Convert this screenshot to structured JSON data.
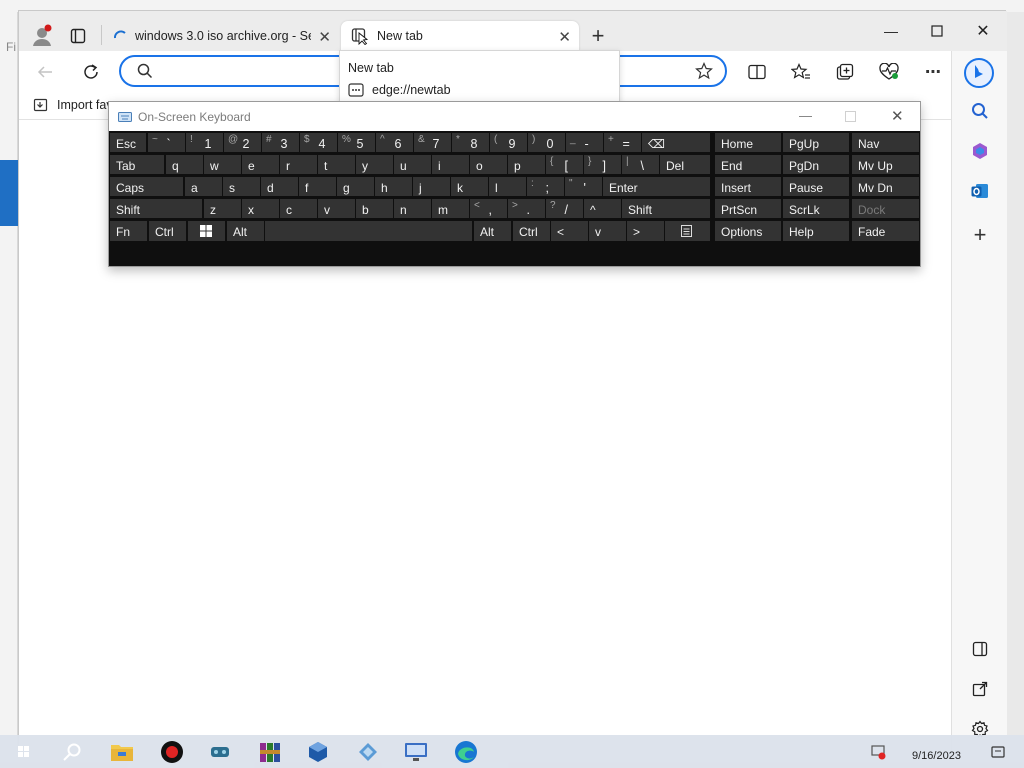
{
  "browser": {
    "tabs": [
      {
        "label": "windows 3.0 iso archive.org - Sea",
        "active": false
      },
      {
        "label": "New tab",
        "active": true
      }
    ],
    "address": {
      "value": "",
      "placeholder": ""
    },
    "dropdown": {
      "header": "New tab",
      "suggestion": "edge://newtab"
    },
    "favorites": {
      "import_label": "Import fav"
    }
  },
  "osk": {
    "title": "On-Screen Keyboard",
    "keys": [
      {
        "main": "Esc"
      },
      {
        "shift": "~",
        "main": "`"
      },
      {
        "shift": "!",
        "main": "1"
      },
      {
        "shift": "@",
        "main": "2"
      },
      {
        "shift": "#",
        "main": "3"
      },
      {
        "shift": "$",
        "main": "4"
      },
      {
        "shift": "%",
        "main": "5"
      },
      {
        "shift": "^",
        "main": "6"
      },
      {
        "shift": "&",
        "main": "7"
      },
      {
        "shift": "*",
        "main": "8"
      },
      {
        "shift": "(",
        "main": "9"
      },
      {
        "shift": ")",
        "main": "0"
      },
      {
        "shift": "_",
        "main": "-"
      },
      {
        "shift": "+",
        "main": "="
      },
      {
        "main": "⌫"
      },
      {
        "main": "Tab"
      },
      {
        "main": "q"
      },
      {
        "main": "w"
      },
      {
        "main": "e"
      },
      {
        "main": "r"
      },
      {
        "main": "t"
      },
      {
        "main": "y"
      },
      {
        "main": "u"
      },
      {
        "main": "i"
      },
      {
        "main": "o"
      },
      {
        "main": "p"
      },
      {
        "shift": "{",
        "main": "["
      },
      {
        "shift": "}",
        "main": "]"
      },
      {
        "shift": "|",
        "main": "\\"
      },
      {
        "main": "Del"
      },
      {
        "main": "Caps"
      },
      {
        "main": "a"
      },
      {
        "main": "s"
      },
      {
        "main": "d"
      },
      {
        "main": "f"
      },
      {
        "main": "g"
      },
      {
        "main": "h"
      },
      {
        "main": "j"
      },
      {
        "main": "k"
      },
      {
        "main": "l"
      },
      {
        "shift": ":",
        "main": ";"
      },
      {
        "shift": "\"",
        "main": "'"
      },
      {
        "main": "Enter"
      },
      {
        "main": "Shift"
      },
      {
        "main": "z"
      },
      {
        "main": "x"
      },
      {
        "main": "c"
      },
      {
        "main": "v"
      },
      {
        "main": "b"
      },
      {
        "main": "n"
      },
      {
        "main": "m"
      },
      {
        "shift": "<",
        "main": ","
      },
      {
        "shift": ">",
        "main": "."
      },
      {
        "shift": "?",
        "main": "/"
      },
      {
        "main": "^"
      },
      {
        "main": "Shift"
      },
      {
        "main": "Fn"
      },
      {
        "main": "Ctrl"
      },
      {
        "main": ""
      },
      {
        "main": "Alt"
      },
      {
        "main": ""
      },
      {
        "main": "Alt"
      },
      {
        "main": "Ctrl"
      },
      {
        "main": "<"
      },
      {
        "main": "v"
      },
      {
        "main": ">"
      },
      {
        "main": ""
      },
      {
        "main": "Home"
      },
      {
        "main": "PgUp"
      },
      {
        "main": "Nav"
      },
      {
        "main": "End"
      },
      {
        "main": "PgDn"
      },
      {
        "main": "Mv Up"
      },
      {
        "main": "Insert"
      },
      {
        "main": "Pause"
      },
      {
        "main": "Mv Dn"
      },
      {
        "main": "PrtScn"
      },
      {
        "main": "ScrLk"
      },
      {
        "main": "Dock"
      },
      {
        "main": "Options"
      },
      {
        "main": "Help"
      },
      {
        "main": "Fade"
      }
    ]
  },
  "taskbar": {
    "date": "9/16/2023"
  },
  "host": {
    "left_label": "Fi"
  },
  "colors": {
    "accent": "#1a73e8",
    "osk_bg": "#0f0f0f",
    "key_bg": "#333333",
    "bing": "#1a73e8"
  }
}
